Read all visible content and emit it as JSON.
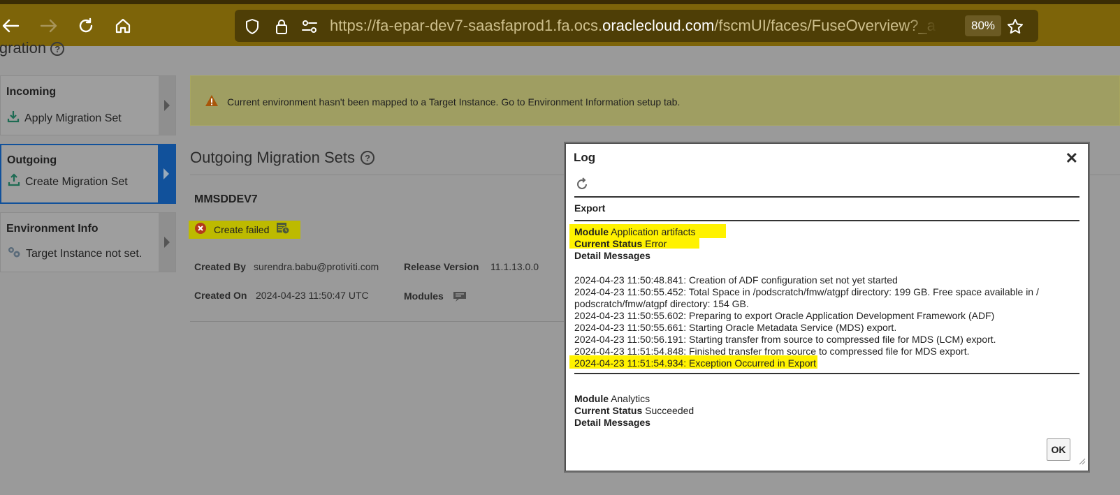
{
  "browser": {
    "url_prefix": "https://fa-epar-dev7-saasfaprod1.fa.ocs.",
    "url_host": "oraclecloud.com",
    "url_suffix": "/fscmUI/faces/FuseOverview?_adf.ctrl-stat",
    "zoom": "80%",
    "icons": [
      "back-icon",
      "forward-icon",
      "reload-icon",
      "home-icon",
      "shield-icon",
      "lock-icon",
      "permissions-icon",
      "star-icon"
    ],
    "accent": "#7d6409"
  },
  "page": {
    "title": "igration",
    "sidebar": [
      {
        "title": "Incoming",
        "action": "Apply Migration Set",
        "icon": "download-icon"
      },
      {
        "title": "Outgoing",
        "action": "Create Migration Set",
        "icon": "upload-icon"
      },
      {
        "title": "Environment Info",
        "action": "Target Instance not set.",
        "icon": "gears-icon"
      }
    ],
    "warning": "Current environment hasn't been mapped to a Target Instance. Go to Environment Information setup tab.",
    "section_title": "Outgoing Migration Sets",
    "set_name": "MMSDDEV7",
    "status": "Create failed",
    "created_by_label": "Created By",
    "created_by": "surendra.babu@protiviti.com",
    "release_label": "Release Version",
    "release": "11.1.13.0.0",
    "created_on_label": "Created On",
    "created_on": "2024-04-23 11:50:47 UTC",
    "modules_label": "Modules"
  },
  "dialog": {
    "title": "Log",
    "close": "✕",
    "section": "Export",
    "module_label": "Module",
    "status_label": "Current Status",
    "detail_label": "Detail Messages",
    "module1": "Application artifacts",
    "status1": "Error",
    "log": [
      "2024-04-23 11:50:48.841: Creation of ADF configuration set not yet started",
      "2024-04-23 11:50:55.452: Total Space in /podscratch/fmw/atgpf directory: 199 GB. Free space available in /\npodscratch/fmw/atgpf directory: 154 GB.",
      "2024-04-23 11:50:55.602: Preparing to export Oracle Application Development Framework (ADF)",
      "2024-04-23 11:50:55.661: Starting Oracle Metadata Service (MDS) export.",
      "2024-04-23 11:50:56.191: Starting transfer from source to compressed file for MDS (LCM) export.",
      "2024-04-23 11:51:54.848: Finished transfer from source to compressed file for MDS export.",
      "2024-04-23 11:51:54.934: Exception Occurred in Export"
    ],
    "module2": "Analytics",
    "status2": "Succeeded",
    "ok": "OK",
    "highlight": "#fff200"
  }
}
